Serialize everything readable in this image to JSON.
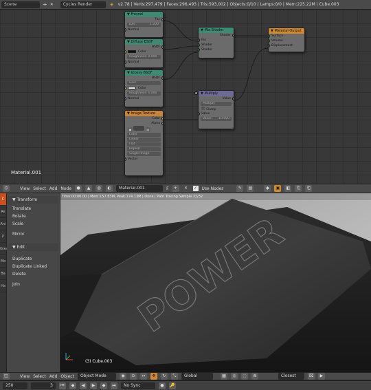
{
  "topbar": {
    "scene": "Scene",
    "add": "+",
    "close": "✕",
    "engine": "Cycles Render",
    "stats": "v2.78 | Verts:297,479 | Faces:296,493 | Tris:593,002 | Objects:0/10 | Lamps:0/0 | Mem:225.22M | Cube.003"
  },
  "nodes": {
    "fresnel": {
      "title": "Fresnel",
      "fac": "Fac",
      "ior": "IOR:",
      "ior_val": "1.200",
      "normal": "Normal"
    },
    "diffuse": {
      "title": "Diffuse BSDF",
      "bsdf": "BSDF",
      "color": "Color",
      "roughness": "Roughness: 0.000",
      "normal": "Normal"
    },
    "glossy": {
      "title": "Glossy BSDF",
      "bsdf": "BSDF",
      "mode": "GGX",
      "color": "Color",
      "roughness": "Roughness: 0.000",
      "normal": "Normal"
    },
    "image_texture": {
      "title": "Image Texture",
      "color": "Color",
      "alpha": "Alpha",
      "opts": [
        "Color",
        "Linear",
        "Flat",
        "Repeat",
        "Single Image"
      ],
      "vector": "Vector"
    },
    "mix_shader": {
      "title": "Mix Shader",
      "shader_out": "Shader",
      "fac": "Fac",
      "shader1": "Shader",
      "shader2": "Shader"
    },
    "material_output": {
      "title": "Material Output",
      "surface": "Surface",
      "volume": "Volume",
      "displacement": "Displacement"
    },
    "multiply": {
      "title": "Multiply",
      "value_out": "Value",
      "op": "Multiply",
      "clamp": "Clamp",
      "value_in": "Value",
      "value_field": "Value:",
      "value_val": "10.000"
    }
  },
  "node_editor": {
    "material_label": "Material.001"
  },
  "node_header": {
    "menus": [
      "View",
      "Select",
      "Add",
      "Node"
    ],
    "material_field": "Material.001",
    "fake_user": "F",
    "use_nodes_label": "Use Nodes",
    "use_nodes_checked": "✓"
  },
  "tool_tabs": [
    "C",
    "Re",
    "Ani",
    "P",
    "Grea",
    "Mo",
    "Ba",
    "Ha"
  ],
  "tool_panel": {
    "transform_title": "Transform",
    "transform_items": [
      "Translate",
      "Rotate",
      "Scale",
      "Mirror"
    ],
    "edit_title": "Edit",
    "edit_items": [
      "Duplicate",
      "Duplicate Linked",
      "Delete",
      "Join"
    ]
  },
  "viewport": {
    "status": "Time:00:00.00 | Mem:157.83M, Peak:174.13M | Done | Path Tracing Sample 32/32",
    "embossed_text": "POWER",
    "object_label": "(3) Cube.003"
  },
  "view3d_header": {
    "menus": [
      "View",
      "Select",
      "Add",
      "Object"
    ],
    "mode": "Object Mode",
    "pivot": "Global",
    "snap": "Closest"
  },
  "timeline": {
    "start": "250",
    "current": "3",
    "sync": "No Sync"
  },
  "colors": {
    "node_output_header": "#d0892c",
    "shader_header": "#3f8a73",
    "converter_header": "#6d6a95",
    "accent": "#d0892c"
  }
}
